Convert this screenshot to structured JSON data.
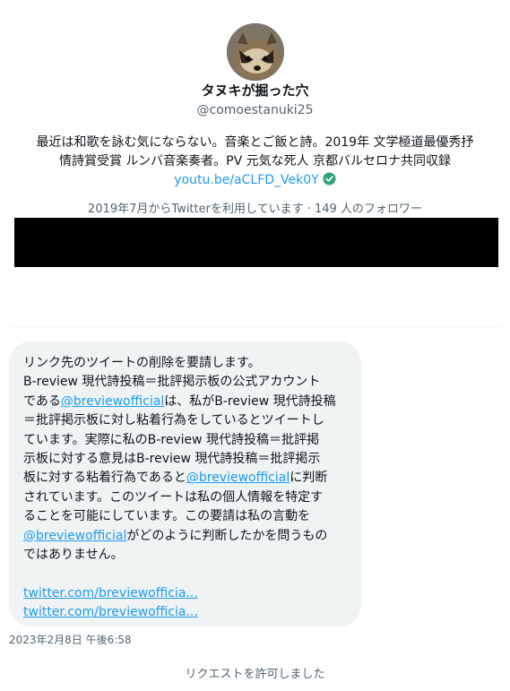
{
  "profile": {
    "display_name": "タヌキが掘った穴",
    "handle": "@comoestanuki25",
    "bio_line1": "最近は和歌を詠む気にならない。音楽とご飯と詩。2019年 文学極道最優秀抒",
    "bio_line2": "情詩賞受賞 ルンバ音楽奏者。PV 元気な死人 京都バルセロナ共同収録",
    "bio_link": "youtu.be/aCLFD_Vek0Y",
    "meta": "2019年7月からTwitterを利用しています · 149 人のフォロワー"
  },
  "message": {
    "line1": "リンク先のツイートの削除を要請します。",
    "line2": "B-review 現代詩投稿＝批評掲示板の公式アカウント",
    "line3_pre": "である",
    "mention": "@breviewofficial",
    "line3_post": "は、私がB-review 現代詩投稿",
    "line4": "＝批評掲示板に対し粘着行為をしているとツイートし",
    "line5": "ています。実際に私のB-review 現代詩投稿＝批評掲",
    "line6": "示板に対する意見はB-review 現代詩投稿＝批評掲示",
    "line7_pre": "板に対する粘着行為であると",
    "line7_post": "に判断",
    "line8": "されています。このツイートは私の個人情報を特定す",
    "line9": "ることを可能にしています。この要請は私の言動を",
    "line10_post": "がどのように判断したかを問うもの",
    "line11": "ではありません。",
    "link1": "twitter.com/breviewofficia...",
    "link2": "twitter.com/breviewofficia..."
  },
  "timestamp": "2023年2月8日 午後6:58",
  "request_status": "リクエストを許可しました",
  "colors": {
    "accent": "#1d9bf0",
    "bubble": "#eff3f4",
    "secondary_text": "#536471"
  }
}
